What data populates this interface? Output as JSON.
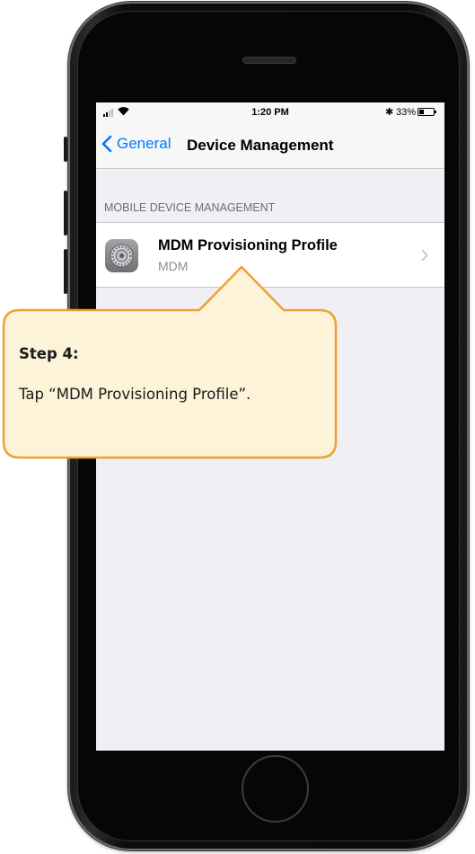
{
  "status_bar": {
    "time": "1:20 PM",
    "battery_percent": "33%",
    "bluetooth_glyph": "✱",
    "battery_level": 0.33,
    "icons": [
      "signal-icon",
      "wifi-icon",
      "bluetooth-icon",
      "battery-icon"
    ]
  },
  "nav": {
    "back_label": "General",
    "title": "Device Management"
  },
  "section": {
    "header": "MOBILE DEVICE MANAGEMENT"
  },
  "profile_row": {
    "title": "MDM Provisioning Profile",
    "subtitle": "MDM",
    "icon": "settings-gear-icon"
  },
  "callout": {
    "title": "Step 4:",
    "body": "Tap “MDM Provisioning Profile”."
  },
  "colors": {
    "accent": "#007aff",
    "callout_fill": "#fdf3d9",
    "callout_border": "#f0a030",
    "screen_background": "#efeff4"
  }
}
